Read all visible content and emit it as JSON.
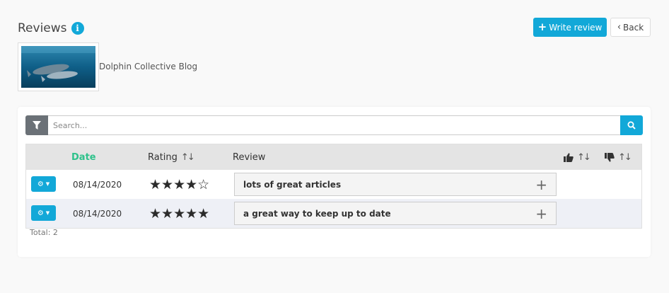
{
  "header": {
    "title": "Reviews",
    "info_glyph": "i",
    "write_review_label": "Write review",
    "back_label": "Back"
  },
  "blog": {
    "name": "Dolphin Collective Blog"
  },
  "search": {
    "placeholder": "Search..."
  },
  "table": {
    "columns": {
      "date": "Date",
      "rating": "Rating",
      "review": "Review"
    },
    "rows": [
      {
        "date": "08/14/2020",
        "rating": 4,
        "stars": "★★★★☆",
        "review": "lots of great articles"
      },
      {
        "date": "08/14/2020",
        "rating": 5,
        "stars": "★★★★★",
        "review": "a great way to keep up to date"
      }
    ],
    "total": "Total: 2"
  },
  "colors": {
    "accent": "#12a8d8",
    "sort_active": "#2ec28b",
    "filter": "#6b7177"
  },
  "icons": [
    "info-icon",
    "plus-icon",
    "chevron-left-icon",
    "filter-icon",
    "search-icon",
    "gear-icon",
    "caret-down-icon",
    "thumbs-up-icon",
    "thumbs-down-icon",
    "sort-icon",
    "star-icon",
    "expand-icon"
  ]
}
